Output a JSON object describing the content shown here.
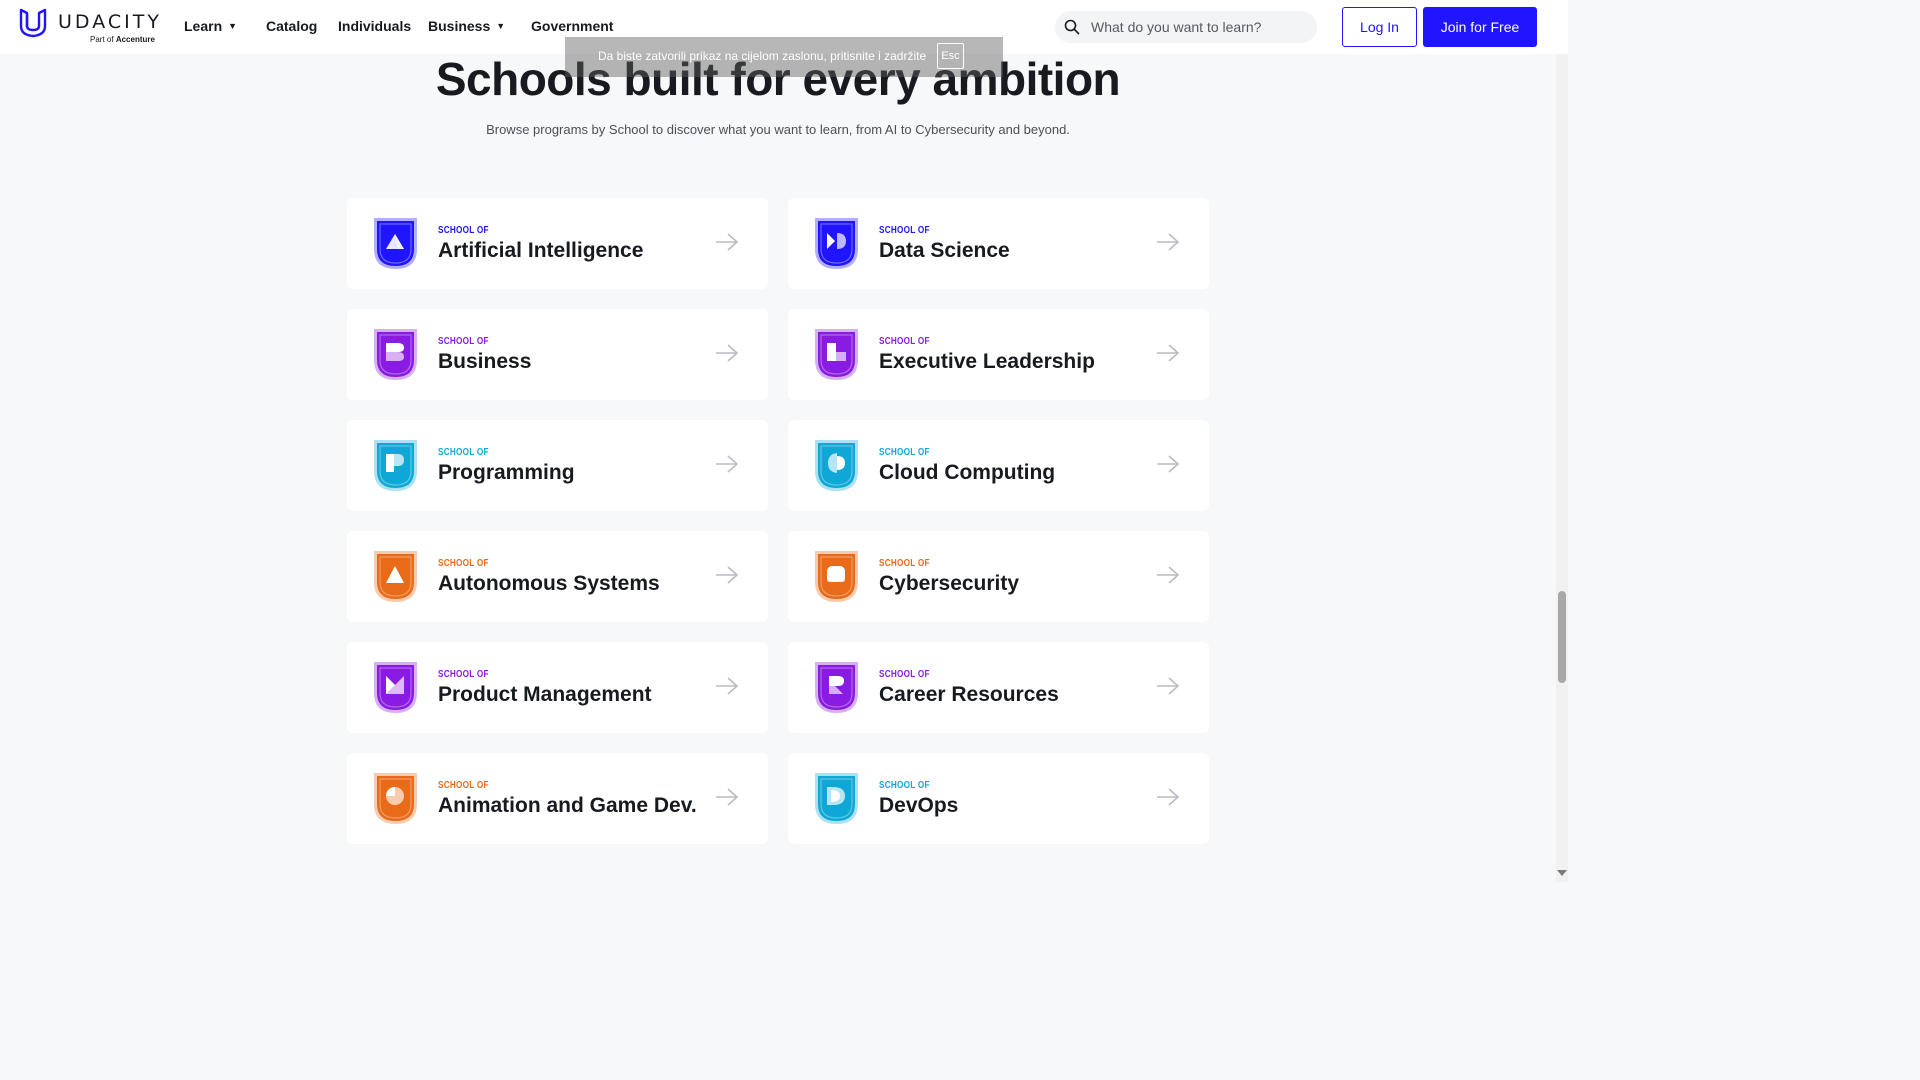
{
  "header": {
    "logo_text": "UDACITY",
    "logo_sub_prefix": "Part of",
    "logo_sub_brand": "Accenture",
    "nav": [
      "Learn",
      "Catalog",
      "Individuals",
      "Business",
      "Government"
    ],
    "search_placeholder": "What do you want to learn?",
    "login_label": "Log In",
    "join_label": "Join for Free",
    "brand_color": "#2015ff"
  },
  "fullscreen_notice": {
    "text": "Da biste zatvorili prikaz na cijelom zaslonu, pritisnite i zadržite",
    "key": "Esc"
  },
  "page": {
    "title": "Schools built for every ambition",
    "subtitle": "Browse programs by School to discover what you want to learn, from AI to Cybersecurity and beyond."
  },
  "schools": [
    {
      "kicker": "SCHOOL OF",
      "name": "Artificial Intelligence",
      "color": "#2015ff",
      "icon": "ai-shield-icon"
    },
    {
      "kicker": "SCHOOL OF",
      "name": "Data Science",
      "color": "#2015ff",
      "icon": "data-science-shield-icon"
    },
    {
      "kicker": "SCHOOL OF",
      "name": "Business",
      "color": "#8a1be2",
      "icon": "business-shield-icon"
    },
    {
      "kicker": "SCHOOL OF",
      "name": "Executive Leadership",
      "color": "#8a1be2",
      "icon": "executive-leadership-shield-icon"
    },
    {
      "kicker": "SCHOOL OF",
      "name": "Programming",
      "color": "#0fa8d6",
      "icon": "programming-shield-icon"
    },
    {
      "kicker": "SCHOOL OF",
      "name": "Cloud Computing",
      "color": "#0fa8d6",
      "icon": "cloud-computing-shield-icon"
    },
    {
      "kicker": "SCHOOL OF",
      "name": "Autonomous Systems",
      "color": "#e96a18",
      "icon": "autonomous-systems-shield-icon"
    },
    {
      "kicker": "SCHOOL OF",
      "name": "Cybersecurity",
      "color": "#e96a18",
      "icon": "cybersecurity-shield-icon"
    },
    {
      "kicker": "SCHOOL OF",
      "name": "Product Management",
      "color": "#8a1be2",
      "icon": "product-management-shield-icon"
    },
    {
      "kicker": "SCHOOL OF",
      "name": "Career Resources",
      "color": "#8a1be2",
      "icon": "career-resources-shield-icon"
    },
    {
      "kicker": "SCHOOL OF",
      "name": "Animation and Game Dev.",
      "color": "#e96a18",
      "icon": "animation-game-dev-shield-icon"
    },
    {
      "kicker": "SCHOOL OF",
      "name": "DevOps",
      "color": "#0fa8d6",
      "icon": "devops-shield-icon"
    }
  ]
}
